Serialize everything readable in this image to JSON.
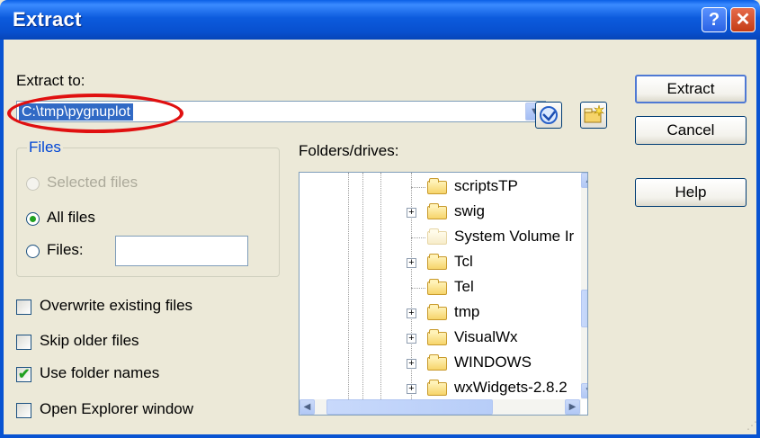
{
  "window": {
    "title": "Extract",
    "help_button": "?",
    "close_button": "✕"
  },
  "extract_to": {
    "label": "Extract to:",
    "path": "C:\\tmp\\pygnuplot",
    "dropdown_icon": "chevron-down-icon"
  },
  "buttons": {
    "extract": "Extract",
    "cancel": "Cancel",
    "help": "Help"
  },
  "files_group": {
    "title": "Files",
    "options": [
      {
        "label": "Selected files",
        "state": "disabled"
      },
      {
        "label": "All files",
        "state": "selected"
      },
      {
        "label": "Files:",
        "state": "unselected"
      }
    ],
    "files_field": ""
  },
  "checkboxes": [
    {
      "label": "Overwrite existing files",
      "checked": false
    },
    {
      "label": "Skip older files",
      "checked": false
    },
    {
      "label": "Use folder names",
      "checked": true
    },
    {
      "label": "Open Explorer window",
      "checked": false
    }
  ],
  "folders": {
    "label": "Folders/drives:",
    "items": [
      {
        "name": "scriptsTP",
        "expandable": false,
        "hidden": false
      },
      {
        "name": "swig",
        "expandable": true,
        "hidden": false
      },
      {
        "name": "System Volume Ir",
        "expandable": false,
        "hidden": true
      },
      {
        "name": "Tcl",
        "expandable": true,
        "hidden": false
      },
      {
        "name": "Tel",
        "expandable": false,
        "hidden": false
      },
      {
        "name": "tmp",
        "expandable": true,
        "hidden": false
      },
      {
        "name": "VisualWx",
        "expandable": true,
        "hidden": false
      },
      {
        "name": "WINDOWS",
        "expandable": true,
        "hidden": false
      },
      {
        "name": "wxWidgets-2.8.2",
        "expandable": true,
        "hidden": false
      }
    ]
  },
  "colors": {
    "titlebar": "#0853d2",
    "dialog_face": "#ece9d8",
    "selection": "#316ac5",
    "annotation": "#e01010",
    "check_green": "#21a121"
  }
}
